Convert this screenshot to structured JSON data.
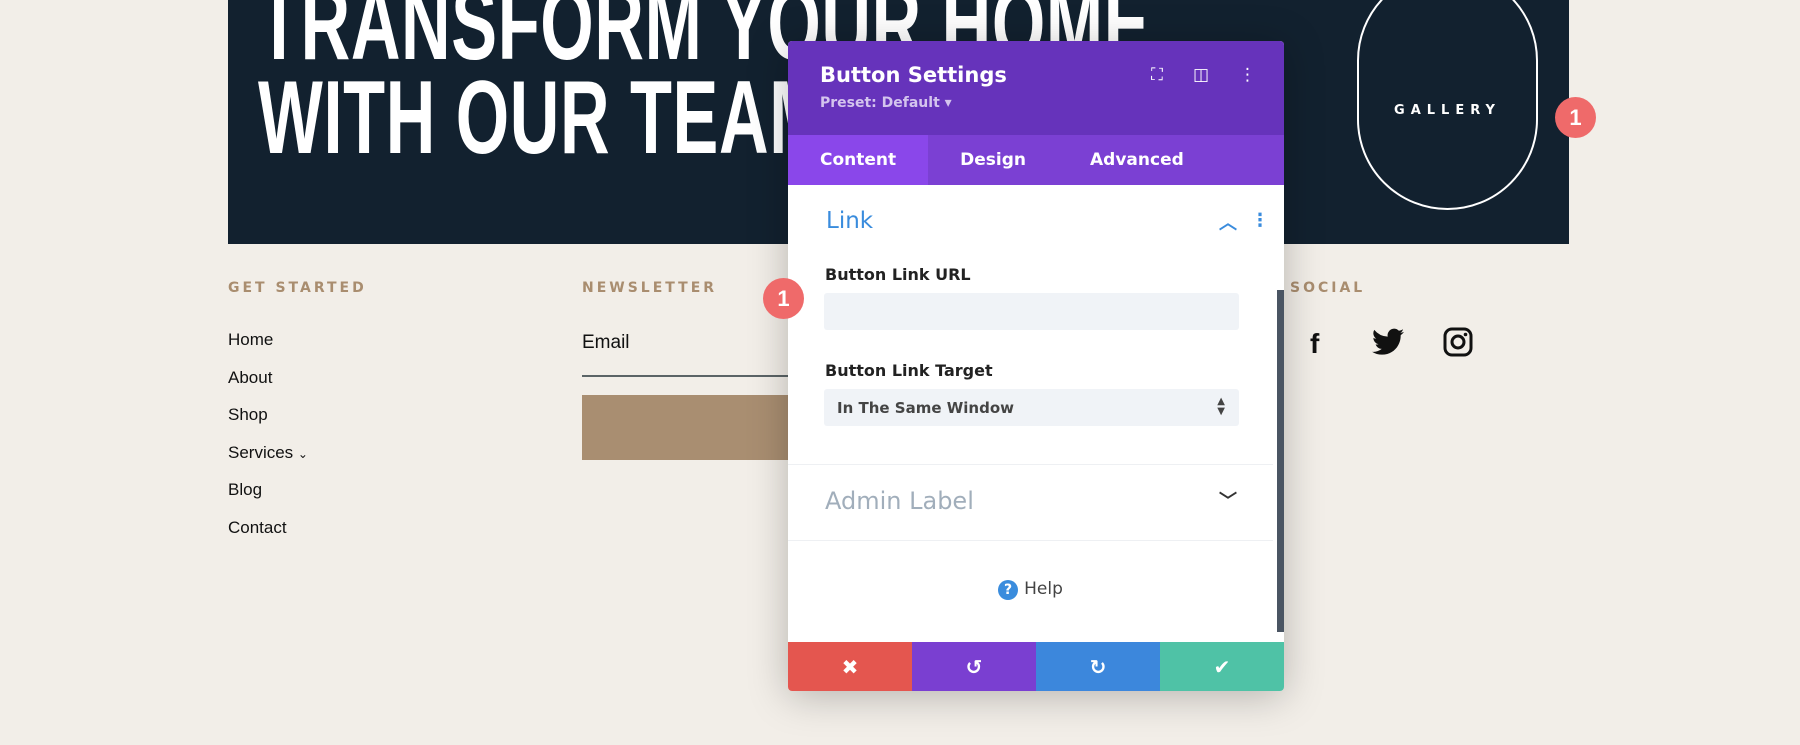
{
  "hero": {
    "line1": "TRANSFORM YOUR HOME",
    "line2": "WITH OUR TEAM",
    "gallery_button": "GALLERY"
  },
  "badges": {
    "gallery": "1",
    "url_field": "1"
  },
  "footer": {
    "get_started": {
      "heading": "GET STARTED",
      "links": [
        "Home",
        "About",
        "Shop",
        "Services",
        "Blog",
        "Contact"
      ]
    },
    "newsletter": {
      "heading": "NEWSLETTER",
      "email_placeholder": "Email"
    },
    "social": {
      "heading": "SOCIAL",
      "icons": [
        "facebook-icon",
        "twitter-icon",
        "instagram-icon"
      ]
    }
  },
  "panel": {
    "title": "Button Settings",
    "preset": "Preset: Default ▾",
    "tabs": [
      "Content",
      "Design",
      "Advanced"
    ],
    "active_tab": "Content",
    "link_section": "Link",
    "url_label": "Button Link URL",
    "url_value": "",
    "target_label": "Button Link Target",
    "target_value": "In The Same Window",
    "admin_section": "Admin Label",
    "help": "Help"
  },
  "colors": {
    "accent": "#6633bb",
    "cancel": "#e4564f",
    "undo": "#7a3fd1",
    "redo": "#3c87dc",
    "save": "#4fc2a6"
  }
}
